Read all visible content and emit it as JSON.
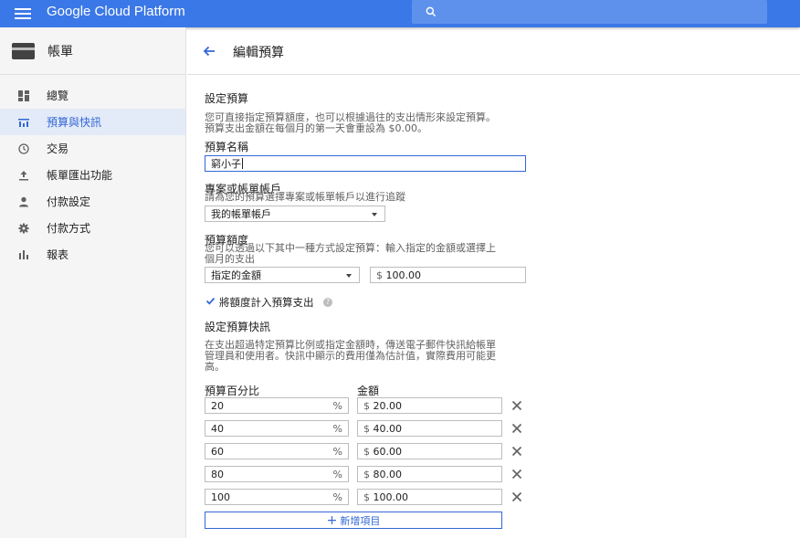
{
  "header": {
    "brand": "Google Cloud Platform"
  },
  "sidebar": {
    "title": "帳單",
    "items": [
      {
        "label": "總覽",
        "icon": "dashboard-icon",
        "active": false
      },
      {
        "label": "預算與快訊",
        "icon": "budget-icon",
        "active": true
      },
      {
        "label": "交易",
        "icon": "clock-icon",
        "active": false
      },
      {
        "label": "帳單匯出功能",
        "icon": "export-icon",
        "active": false
      },
      {
        "label": "付款設定",
        "icon": "person-icon",
        "active": false
      },
      {
        "label": "付款方式",
        "icon": "gear-icon",
        "active": false
      },
      {
        "label": "報表",
        "icon": "bar-chart-icon",
        "active": false
      }
    ]
  },
  "page": {
    "title": "編輯預算"
  },
  "budget": {
    "section_title": "設定預算",
    "section_desc_1": "您可直接指定預算額度，也可以根據過往的支出情形來設定預算。",
    "section_desc_2": "預算支出金額在每個月的第一天會重設為 $0.00。",
    "name_label": "預算名稱",
    "name_value": "窮小子",
    "project_label": "專案或帳單帳戶",
    "project_desc": "請為您的預算選擇專案或帳單帳戶以進行追蹤",
    "project_value": "我的帳單帳戶",
    "amount_label": "預算額度",
    "amount_desc_1": "您可以透過以下其中一種方式設定預算：輸入指定的金額或選擇上",
    "amount_desc_2": "個月的支出",
    "amount_type": "指定的金額",
    "amount_currency": "$",
    "amount_value": "100.00",
    "include_credits_label": "將額度計入預算支出",
    "include_credits_checked": true
  },
  "alerts": {
    "title": "設定預算快訊",
    "desc_1": "在支出超過特定預算比例或指定金額時，傳送電子郵件快訊給帳單",
    "desc_2": "管理員和使用者。快訊中顯示的費用僅為估計值，實際費用可能更",
    "desc_3": "高。",
    "col_percent": "預算百分比",
    "col_amount": "金額",
    "percent_suffix": "%",
    "currency": "$",
    "rows": [
      {
        "percent": "20",
        "amount": "20.00"
      },
      {
        "percent": "40",
        "amount": "40.00"
      },
      {
        "percent": "60",
        "amount": "60.00"
      },
      {
        "percent": "80",
        "amount": "80.00"
      },
      {
        "percent": "100",
        "amount": "100.00"
      }
    ],
    "add_label": "新增項目"
  },
  "colors": {
    "accent": "#3b78e7",
    "link": "#3367d6"
  }
}
